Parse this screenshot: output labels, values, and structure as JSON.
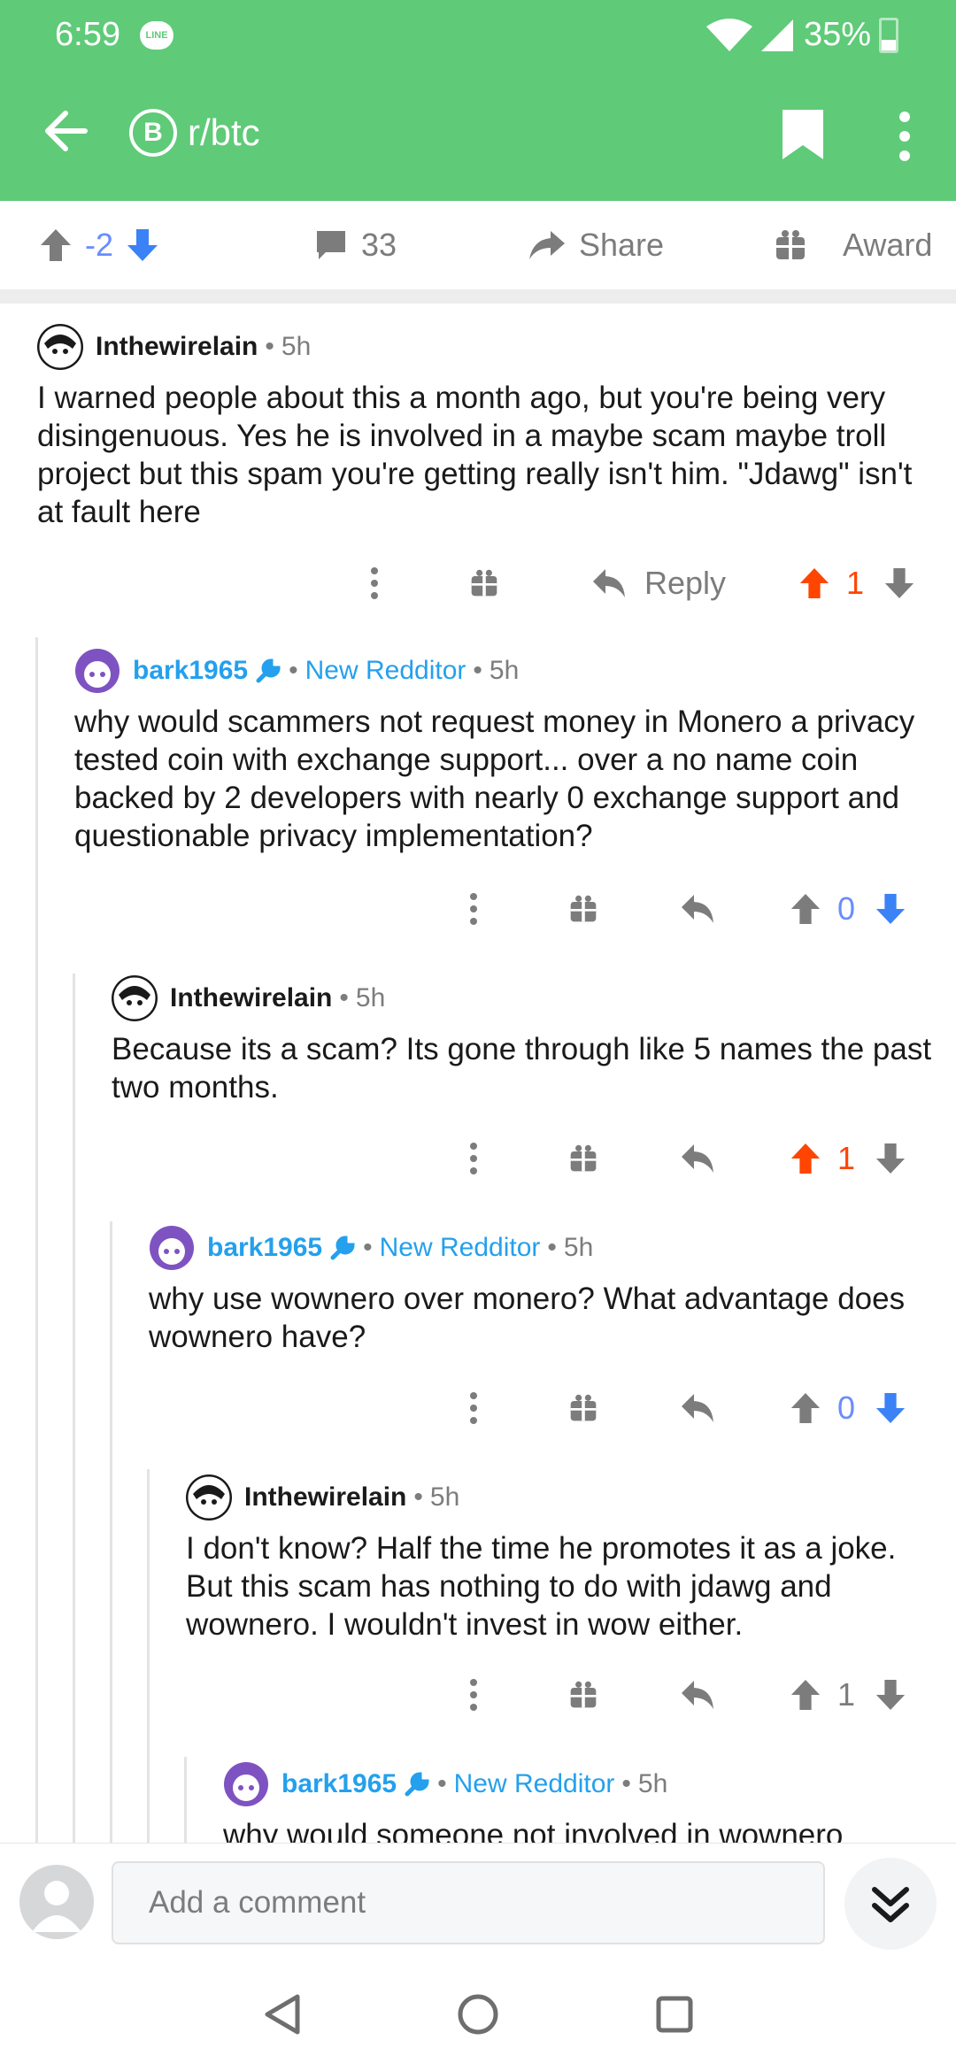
{
  "status_bar": {
    "time": "6:59",
    "notification": "LINE",
    "battery": "35%",
    "battery_level": 0.35
  },
  "header": {
    "subreddit": "r/btc",
    "subreddit_icon_letter": "B"
  },
  "post_bar": {
    "score": "-2",
    "comments": "33",
    "share": "Share",
    "award": "Award"
  },
  "comments": [
    {
      "user": "Inthewirelain",
      "time": "5h",
      "body": "I warned people about this a month ago, but you're being very disingenuous. Yes he is involved in a maybe scam maybe troll project but this spam you're getting really isn't him. \"Jdawg\" isn't at fault here",
      "reply": "Reply",
      "score": "1"
    },
    {
      "user": "bark1965",
      "flair": "New Redditor",
      "time": "5h",
      "body": "why would scammers not request money in Monero a privacy tested coin with exchange support... over a no name coin backed by 2 developers with nearly 0 exchange support and questionable privacy implementation?",
      "score": "0"
    },
    {
      "user": "Inthewirelain",
      "time": "5h",
      "body": "Because its a scam? Its gone through like 5 names the past two months.",
      "score": "1"
    },
    {
      "user": "bark1965",
      "flair": "New Redditor",
      "time": "5h",
      "body": "why use wownero over monero? What advantage does wownero have?",
      "score": "0"
    },
    {
      "user": "Inthewirelain",
      "time": "5h",
      "body": "I don't know? Half the time he promotes it as a joke. But this scam has nothing to do with jdawg and wownero. I wouldn't invest in wow either.",
      "score": "1"
    },
    {
      "user": "bark1965",
      "flair": "New Redditor",
      "time": "5h",
      "body": "why would someone not involved in wownero"
    }
  ],
  "composer": {
    "placeholder": "Add a comment"
  },
  "colors": {
    "header": "#5fca78",
    "upvote": "#ff4500",
    "downvote": "#6a8cff",
    "op_blue": "#24a0ed"
  }
}
